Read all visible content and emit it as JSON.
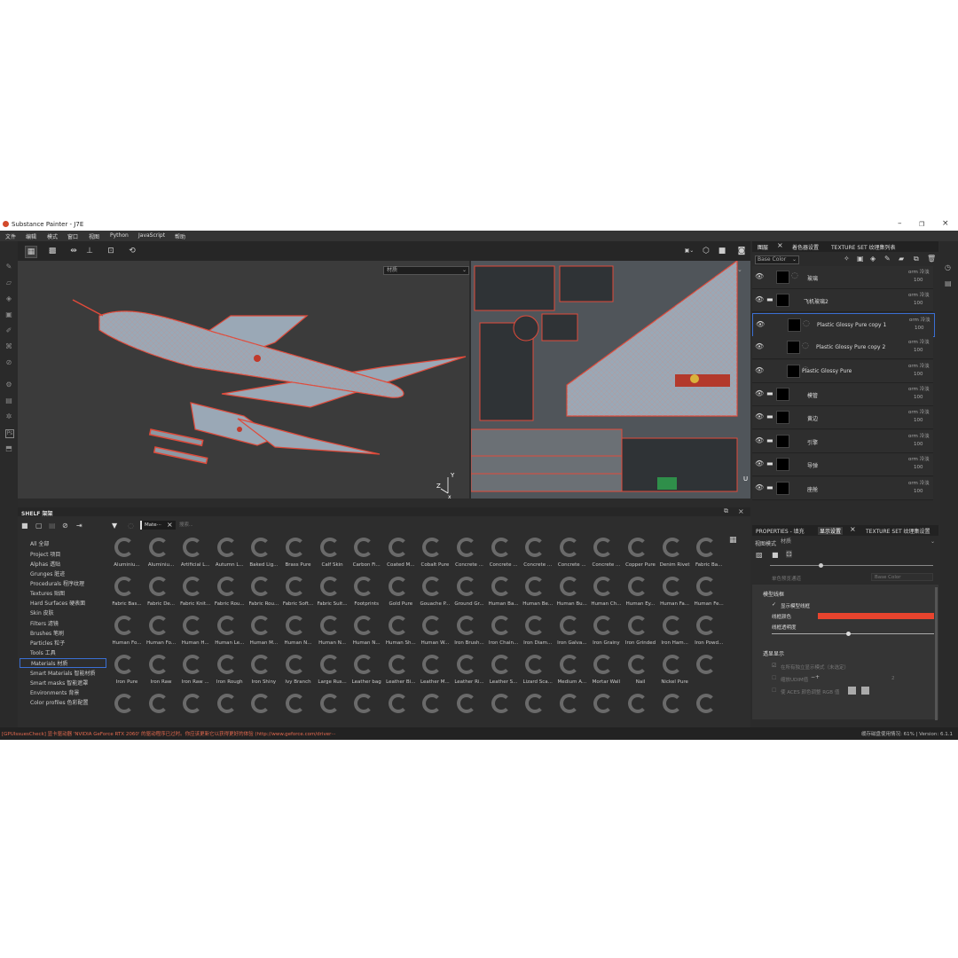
{
  "window": {
    "title": "Substance Painter - J7E"
  },
  "menu": [
    "文件",
    "编辑",
    "模式",
    "窗口",
    "视图",
    "Python",
    "JavaScript",
    "帮助"
  ],
  "viewport": {
    "mode_3d": "材质",
    "mode_uv": "材质"
  },
  "shelf": {
    "title": "SHELF 架架",
    "filter_chip": "Mate···",
    "search_placeholder": "搜索...",
    "categories": [
      "All 全部",
      "Project 项目",
      "Alphas 透贴",
      "Grunges 脏迹",
      "Procedurals 程序纹理",
      "Textures 贴图",
      "Hard Surfaces 硬表面",
      "Skin 皮肤",
      "Filters 滤镜",
      "Brushes 笔刷",
      "Particles 粒子",
      "Tools 工具",
      "Materials 材质",
      "Smart Materials 智能材质",
      "Smart masks 智能遮罩",
      "Environments 背景",
      "Color profiles 色彩配置"
    ],
    "selected_category": "Materials 材质",
    "items": [
      "Aluminiu...",
      "Aluminiu...",
      "Artificial L...",
      "Autumn L...",
      "Baked Lig...",
      "Brass Pure",
      "Calf Skin",
      "Carbon Fi...",
      "Coated M...",
      "Cobalt Pure",
      "Concrete ...",
      "Concrete ...",
      "Concrete ...",
      "Concrete ...",
      "Concrete ...",
      "Copper Pure",
      "Denim Rivet",
      "Fabric Ba...",
      "Fabric Bas...",
      "Fabric De...",
      "Fabric Knit...",
      "Fabric Rou...",
      "Fabric Rou...",
      "Fabric Soft...",
      "Fabric Suit...",
      "Footprints",
      "Gold Pure",
      "Gouache P...",
      "Ground Gr...",
      "Human Ba...",
      "Human Be...",
      "Human Bu...",
      "Human Ch...",
      "Human Ey...",
      "Human Fa...",
      "Human Fe...",
      "Human Fo...",
      "Human Fo...",
      "Human H...",
      "Human Le...",
      "Human M...",
      "Human N...",
      "Human N...",
      "Human N...",
      "Human Sh...",
      "Human W...",
      "Iron Brush...",
      "Iron Chain...",
      "Iron Diam...",
      "Iron Galva...",
      "Iron Grainy",
      "Iron Grinded",
      "Iron Ham...",
      "Iron Powd...",
      "Iron Pure",
      "Iron Raw",
      "Iron Raw ...",
      "Iron Rough",
      "Iron Shiny",
      "Ivy Branch",
      "Large Rus...",
      "Leather bag",
      "Leather Bi...",
      "Leather M...",
      "Leather Ri...",
      "Leather S...",
      "Lizard Sca...",
      "Medium A...",
      "Mortar Wall",
      "Nail",
      "Nickel Pure"
    ]
  },
  "layers_panel": {
    "tabs": [
      "图层",
      "着色器设置",
      "TEXTURE SET 纹理集列表"
    ],
    "channel": "Base Color",
    "layers": [
      {
        "name": "玻璃",
        "blend": "orm 冷淡",
        "opacity": "100"
      },
      {
        "name": "飞机玻璃2",
        "blend": "orm 冷淡",
        "opacity": "100"
      },
      {
        "name": "Plastic Glossy Pure copy 1",
        "blend": "orm 冷淡",
        "opacity": "100"
      },
      {
        "name": "Plastic Glossy Pure copy 2",
        "blend": "orm 冷淡",
        "opacity": "100"
      },
      {
        "name": "Plastic Glossy Pure",
        "blend": "orm 冷淡",
        "opacity": "100"
      },
      {
        "name": "模管",
        "blend": "orm 冷淡",
        "opacity": "100"
      },
      {
        "name": "黄边",
        "blend": "orm 冷淡",
        "opacity": "100"
      },
      {
        "name": "引擎",
        "blend": "orm 冷淡",
        "opacity": "100"
      },
      {
        "name": "导弹",
        "blend": "orm 冷淡",
        "opacity": "100"
      },
      {
        "name": "座舱",
        "blend": "orm 冷淡",
        "opacity": "100"
      }
    ]
  },
  "props_panel": {
    "tabs": [
      "PROPERTIES - 填充",
      "显示设置",
      "TEXTURE SET 纹理集设置"
    ],
    "view_mode_label": "视图模式",
    "view_mode_value": "材质",
    "channel_label": "单色预览通道",
    "channel_value": "Base Color",
    "wire_section": "模型线框",
    "wire_show": "显示模型线框",
    "wire_color_label": "线框颜色",
    "wire_opacity_label": "线框透明度",
    "alpha_section": "透显显示",
    "alpha_row1": "在所有独立显示模式（未选定）",
    "alpha_row2": "缩放UDIM值",
    "alpha_row2_value": "2",
    "alpha_row3": "使 ACES 颜色调整 RGB 值",
    "wire_color": "#e8442e"
  },
  "status": {
    "warning": "[GPUIssuesCheck] 显卡驱动器 'NVIDIA GeForce RTX 2060' 的驱动程序已过时。你应该更新它以获得更好的体验 (http://www.geforce.com/driver···",
    "cache": "缓存磁盘使用情况: 61%",
    "version": "Version: 6.1.1"
  }
}
